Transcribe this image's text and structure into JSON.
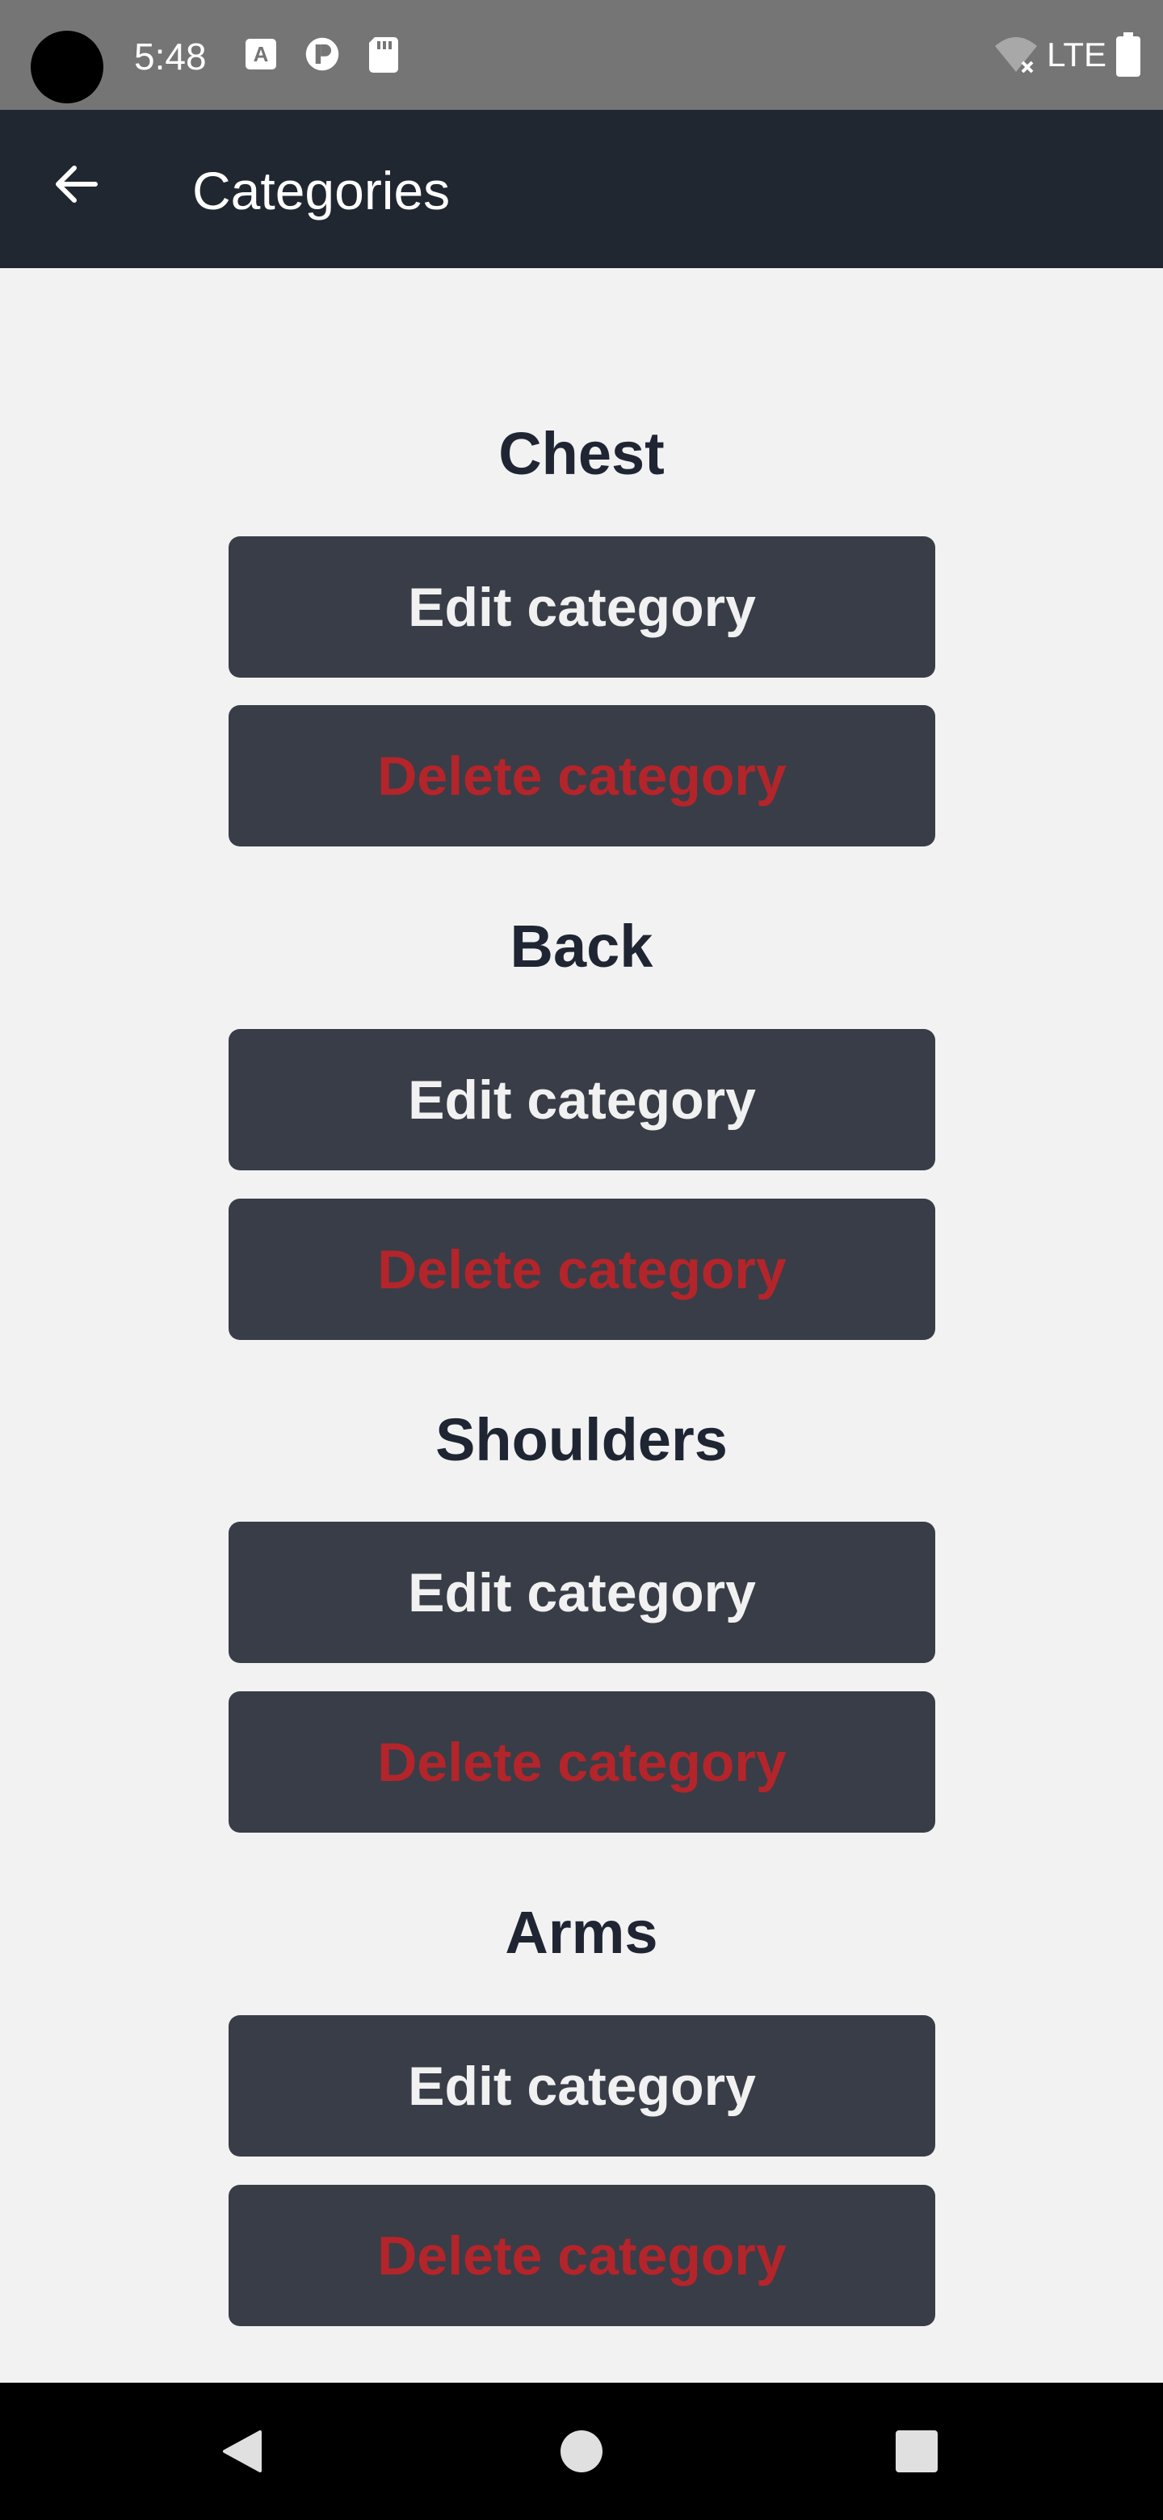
{
  "status_bar": {
    "time": "5:48",
    "network": "LTE",
    "icons_left": [
      "a-icon",
      "p-icon",
      "sd-card-icon"
    ],
    "icons_right": [
      "wifi-off-icon",
      "battery-icon"
    ]
  },
  "app_bar": {
    "title": "Categories",
    "back_icon": "arrow-left-icon"
  },
  "categories": [
    {
      "name": "Chest",
      "edit_label": "Edit category",
      "delete_label": "Delete category"
    },
    {
      "name": "Back",
      "edit_label": "Edit category",
      "delete_label": "Delete category"
    },
    {
      "name": "Shoulders",
      "edit_label": "Edit category",
      "delete_label": "Delete category"
    },
    {
      "name": "Arms",
      "edit_label": "Edit category",
      "delete_label": "Delete category"
    }
  ],
  "nav_bar": {
    "icons": [
      "back-triangle-icon",
      "home-circle-icon",
      "recents-square-icon"
    ]
  },
  "colors": {
    "app_bar": "#212731",
    "button_bg": "#393d47",
    "delete_text": "#b3252a",
    "edit_text": "#f1f1f1",
    "title_text": "#1f2533"
  }
}
